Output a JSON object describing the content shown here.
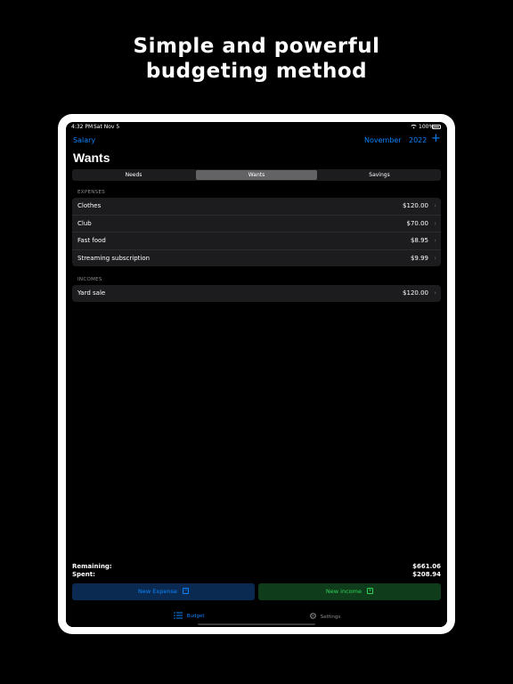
{
  "headline": {
    "line1": "Simple and powerful",
    "line2": "budgeting method"
  },
  "status_bar": {
    "time": "4:32 PM",
    "date": "Sat Nov 5",
    "battery": "100%"
  },
  "nav": {
    "back_label": "Salary",
    "month": "November",
    "year": "2022",
    "add_symbol": "+"
  },
  "page_title": "Wants",
  "segments": {
    "items": [
      "Needs",
      "Wants",
      "Savings"
    ],
    "selected": "Wants"
  },
  "expenses": {
    "header": "EXPENSES",
    "rows": [
      {
        "label": "Clothes",
        "amount": "$120.00"
      },
      {
        "label": "Club",
        "amount": "$70.00"
      },
      {
        "label": "Fast food",
        "amount": "$8.95"
      },
      {
        "label": "Streaming subscription",
        "amount": "$9.99"
      }
    ]
  },
  "incomes": {
    "header": "INCOMES",
    "rows": [
      {
        "label": "Yard sale",
        "amount": "$120.00"
      }
    ]
  },
  "summary": {
    "remaining_label": "Remaining:",
    "remaining_value": "$661.06",
    "spent_label": "Spent:",
    "spent_value": "$208.94"
  },
  "buttons": {
    "new_expense": "New Expense",
    "new_income": "New income"
  },
  "tabs": [
    {
      "label": "Budget",
      "icon": "list-icon",
      "active": true
    },
    {
      "label": "Settings",
      "icon": "gear-icon",
      "active": false
    }
  ],
  "colors": {
    "accent": "#0a84ff",
    "income": "#30d158",
    "background": "#000000",
    "cell": "#1c1c1e"
  }
}
